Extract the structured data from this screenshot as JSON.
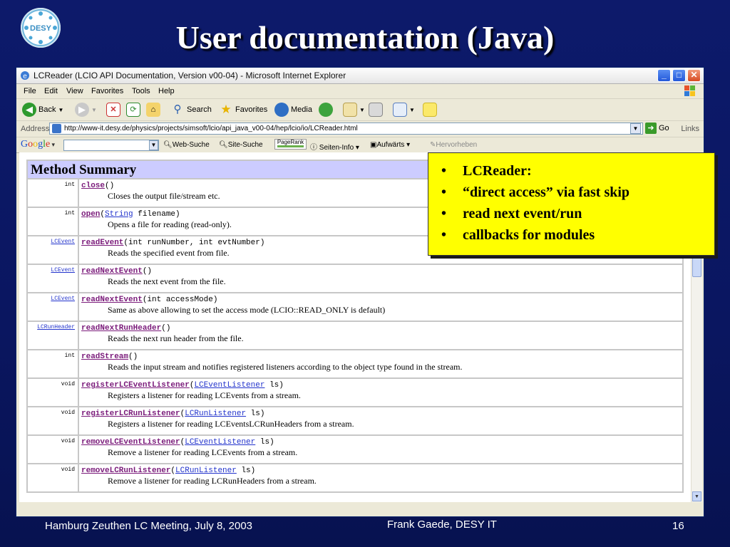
{
  "slide": {
    "title": "User documentation (Java)",
    "logo_text": "DESY",
    "footer_left": "Hamburg Zeuthen LC Meeting, July 8, 2003",
    "footer_center": "Frank Gaede, DESY IT",
    "footer_right": "16"
  },
  "browser": {
    "window_title": "LCReader (LCIO API Documentation, Version v00-04) - Microsoft Internet Explorer",
    "menu": [
      "File",
      "Edit",
      "View",
      "Favorites",
      "Tools",
      "Help"
    ],
    "toolbar": {
      "back": "Back",
      "search": "Search",
      "favorites": "Favorites",
      "media": "Media"
    },
    "address_label": "Address",
    "url": "http://www-it.desy.de/physics/projects/simsoft/lcio/api_java_v00-04/hep/lcio/io/LCReader.html",
    "go": "Go",
    "links": "Links",
    "google_bar": {
      "logo": "Google",
      "web_search": "Web-Suche",
      "site_search": "Site-Suche",
      "pagerank": "PageRank",
      "page_info": "Seiten-Info",
      "up": "Aufwärts",
      "highlight": "Hervorheben"
    }
  },
  "method_summary": {
    "heading": "Method Summary",
    "rows": [
      {
        "type": "int",
        "name": "close",
        "params": [
          {
            "t": "()"
          }
        ],
        "desc": "Closes the output file/stream etc."
      },
      {
        "type": "int",
        "name": "open",
        "params": [
          {
            "t": "("
          },
          {
            "l": "String"
          },
          {
            "t": " filename)"
          }
        ],
        "desc": "Opens a file for reading (read-only)."
      },
      {
        "type": "LCEvent",
        "type_link": true,
        "name": "readEvent",
        "params": [
          {
            "t": "(int runNumber, int evtNumber)"
          }
        ],
        "desc": "Reads the specified event from file."
      },
      {
        "type": "LCEvent",
        "type_link": true,
        "name": "readNextEvent",
        "params": [
          {
            "t": "()"
          }
        ],
        "desc": "Reads the next event from the file."
      },
      {
        "type": "LCEvent",
        "type_link": true,
        "name": "readNextEvent",
        "params": [
          {
            "t": "(int accessMode)"
          }
        ],
        "desc": "Same as above allowing to set the access mode (LCIO::READ_ONLY is default)"
      },
      {
        "type": "LCRunHeader",
        "type_link": true,
        "name": "readNextRunHeader",
        "params": [
          {
            "t": "()"
          }
        ],
        "desc": "Reads the next run header from the file."
      },
      {
        "type": "int",
        "name": "readStream",
        "params": [
          {
            "t": "()"
          }
        ],
        "desc": "Reads the input stream and notifies registered listeners according to the object type found in the stream."
      },
      {
        "type": "void",
        "name": "registerLCEventListener",
        "params": [
          {
            "t": "("
          },
          {
            "l": "LCEventListener"
          },
          {
            "t": " ls)"
          }
        ],
        "desc": "Registers a listener for reading LCEvents from a stream."
      },
      {
        "type": "void",
        "name": "registerLCRunListener",
        "params": [
          {
            "t": "("
          },
          {
            "l": "LCRunListener"
          },
          {
            "t": " ls)"
          }
        ],
        "desc": "Registers a listener for reading LCEventsLCRunHeaders from a stream."
      },
      {
        "type": "void",
        "name": "removeLCEventListener",
        "params": [
          {
            "t": "("
          },
          {
            "l": "LCEventListener"
          },
          {
            "t": " ls)"
          }
        ],
        "desc": "Remove a listener for reading LCEvents from a stream."
      },
      {
        "type": "void",
        "name": "removeLCRunListener",
        "params": [
          {
            "t": "("
          },
          {
            "l": "LCRunListener"
          },
          {
            "t": " ls)"
          }
        ],
        "desc": "Remove a listener for reading LCRunHeaders from a stream."
      }
    ]
  },
  "callout": {
    "bullet": "•",
    "items": [
      "LCReader:",
      "“direct access” via fast skip",
      "read next event/run",
      "callbacks for modules"
    ]
  }
}
